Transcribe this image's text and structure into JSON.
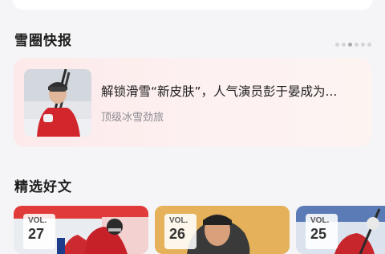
{
  "news_section": {
    "title": "雪圈快报",
    "carousel_pages": 6,
    "active_page": 3,
    "item": {
      "title": "解锁滑雪“新皮肤”，人气演员彭于晏成为...",
      "subtitle": "顶级冰雪劲旅",
      "thumbnail": "skier-photo"
    }
  },
  "featured_section": {
    "title": "精选好文",
    "articles": [
      {
        "vol_label": "VOL.",
        "vol_number": "27",
        "image": "hockey-player-photo"
      },
      {
        "vol_label": "VOL.",
        "vol_number": "26",
        "image": "man-portrait-photo"
      },
      {
        "vol_label": "VOL.",
        "vol_number": "25",
        "image": "skier-photo"
      }
    ]
  },
  "colors": {
    "page_bg": "#f5f5f7",
    "card_bg": "#fdeeee",
    "title_text": "#1e1e1e",
    "subtitle_text": "#8c8c92"
  }
}
